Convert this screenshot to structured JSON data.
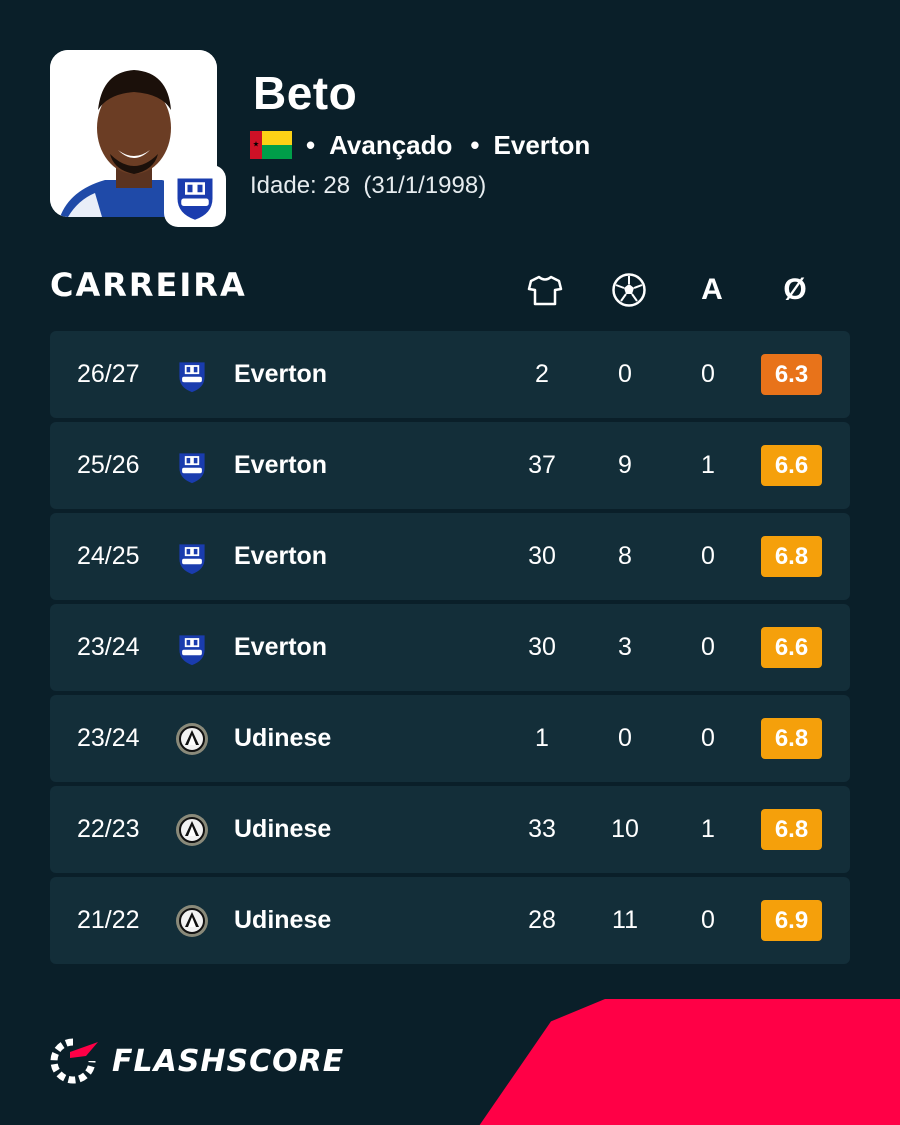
{
  "player": {
    "name": "Beto",
    "position": "Avançado",
    "club": "Everton",
    "age_label": "Idade: 28  (31/1/1998)"
  },
  "colors": {
    "background": "#0a1f29",
    "row": "#132e39",
    "rating_orange_dark": "#e8731a",
    "rating_orange": "#f5a00b",
    "brand_red": "#ff0046"
  },
  "career": {
    "title": "CARREIRA",
    "columns": [
      {
        "name": "appearances",
        "icon": "shirt-icon"
      },
      {
        "name": "goals",
        "icon": "football-icon"
      },
      {
        "name": "assists",
        "label": "A"
      },
      {
        "name": "average-rating",
        "label": "Ø"
      }
    ],
    "rows": [
      {
        "season": "26/27",
        "team": "Everton",
        "crest": "everton-crest-icon",
        "apps": "2",
        "goals": "0",
        "assists": "0",
        "rating": "6.3",
        "rating_color": "#e8731a"
      },
      {
        "season": "25/26",
        "team": "Everton",
        "crest": "everton-crest-icon",
        "apps": "37",
        "goals": "9",
        "assists": "1",
        "rating": "6.6",
        "rating_color": "#f5a00b"
      },
      {
        "season": "24/25",
        "team": "Everton",
        "crest": "everton-crest-icon",
        "apps": "30",
        "goals": "8",
        "assists": "0",
        "rating": "6.8",
        "rating_color": "#f5a00b"
      },
      {
        "season": "23/24",
        "team": "Everton",
        "crest": "everton-crest-icon",
        "apps": "30",
        "goals": "3",
        "assists": "0",
        "rating": "6.6",
        "rating_color": "#f5a00b"
      },
      {
        "season": "23/24",
        "team": "Udinese",
        "crest": "udinese-crest-icon",
        "apps": "1",
        "goals": "0",
        "assists": "0",
        "rating": "6.8",
        "rating_color": "#f5a00b"
      },
      {
        "season": "22/23",
        "team": "Udinese",
        "crest": "udinese-crest-icon",
        "apps": "33",
        "goals": "10",
        "assists": "1",
        "rating": "6.8",
        "rating_color": "#f5a00b"
      },
      {
        "season": "21/22",
        "team": "Udinese",
        "crest": "udinese-crest-icon",
        "apps": "28",
        "goals": "11",
        "assists": "0",
        "rating": "6.9",
        "rating_color": "#f5a00b"
      }
    ]
  },
  "brand": {
    "name": "FLASHSCORE"
  }
}
